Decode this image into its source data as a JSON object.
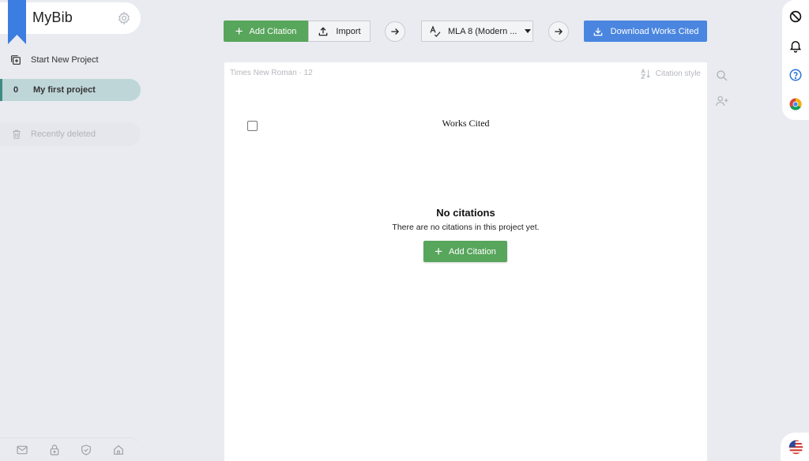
{
  "brand": {
    "name": "MyBib"
  },
  "sidebar": {
    "new_project_label": "Start New Project",
    "project": {
      "count": "0",
      "name": "My first project"
    },
    "deleted_label": "Recently deleted"
  },
  "toolbar": {
    "add_label": "Add Citation",
    "import_label": "Import",
    "style_label": "MLA 8 (Modern ...",
    "download_label": "Download Works Cited"
  },
  "document": {
    "font_info": "Times New Roman · 12",
    "style_label": "Citation style",
    "heading": "Works Cited",
    "empty_title": "No citations",
    "empty_subtitle": "There are no citations in this project yet.",
    "empty_add_label": "Add Citation"
  },
  "icons": {
    "bookmark": "bookmark-ribbon-icon",
    "settings": "gear-icon",
    "new_project": "add-project-icon",
    "trash": "trash-icon",
    "mail": "mail-icon",
    "lock": "lock-icon",
    "shield": "shield-icon",
    "home": "home-icon",
    "upload": "upload-icon",
    "arrow": "arrow-right-icon",
    "spell": "spellcheck-icon",
    "download": "download-icon",
    "sort": "sort-az-icon",
    "search": "search-icon",
    "add_person": "add-person-icon",
    "block": "block-icon",
    "bell": "bell-icon",
    "help": "help-icon",
    "chrome": "chrome-icon",
    "flag": "us-flag-icon"
  },
  "colors": {
    "accent_green": "#58a55c",
    "accent_blue": "#4a86e0",
    "bookmark_blue": "#3b7de0",
    "project_teal": "#bfd6d9",
    "background": "#e9ebf0"
  }
}
